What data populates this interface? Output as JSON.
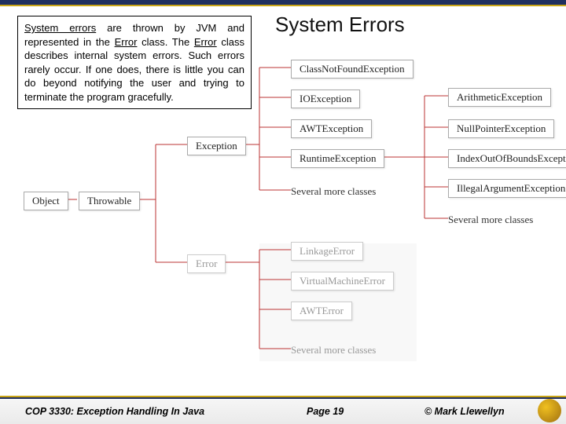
{
  "title": "System Errors",
  "textbox": {
    "underline1": "System errors",
    "plain1": " are thrown by JVM and represented in the ",
    "underline2": "Error",
    "plain2": " class. The ",
    "underline3": "Error",
    "plain3": " class describes internal system errors. Such errors rarely occur. If one does, there is little you can do beyond notifying the user and trying to terminate the program gracefully."
  },
  "nodes": {
    "object": "Object",
    "throwable": "Throwable",
    "exception": "Exception",
    "error": "Error",
    "classnotfound": "ClassNotFoundException",
    "ioexception": "IOException",
    "awtexception": "AWTException",
    "runtimeexception": "RuntimeException",
    "arithmetic": "ArithmeticException",
    "nullpointer": "NullPointerException",
    "indexoob": "IndexOutOfBoundsException",
    "illegalarg": "IllegalArgumentException",
    "linkage": "LinkageError",
    "vmerror": "VirtualMachineError",
    "awterror": "AWTError"
  },
  "more1": "Several more classes",
  "more2": "Several more classes",
  "more3": "Several more classes",
  "footer": {
    "left": "COP 3330: Exception Handling In Java",
    "mid": "Page 19",
    "right": "© Mark Llewellyn"
  }
}
